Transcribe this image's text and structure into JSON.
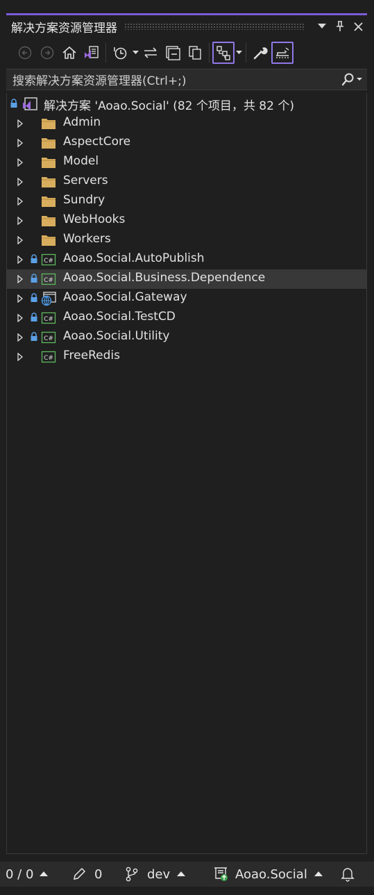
{
  "panel": {
    "title": "解决方案资源管理器",
    "accent_color": "#7c5cd6"
  },
  "search": {
    "placeholder": "搜索解决方案资源管理器(Ctrl+;)"
  },
  "solution": {
    "label": "解决方案 'Aoao.Social' (82 个项目，共 82 个)"
  },
  "tree": {
    "folders": [
      {
        "label": "Admin"
      },
      {
        "label": "AspectCore"
      },
      {
        "label": "Model"
      },
      {
        "label": "Servers"
      },
      {
        "label": "Sundry"
      },
      {
        "label": "WebHooks"
      },
      {
        "label": "Workers"
      }
    ],
    "projects": [
      {
        "label": "Aoao.Social.AutoPublish",
        "icon": "csharp-project-icon",
        "locked": true
      },
      {
        "label": "Aoao.Social.Business.Dependence",
        "icon": "csharp-project-icon",
        "locked": true,
        "selected": true
      },
      {
        "label": "Aoao.Social.Gateway",
        "icon": "web-project-icon",
        "locked": true
      },
      {
        "label": "Aoao.Social.TestCD",
        "icon": "csharp-project-icon",
        "locked": true
      },
      {
        "label": "Aoao.Social.Utility",
        "icon": "csharp-project-icon",
        "locked": true
      },
      {
        "label": "FreeRedis",
        "icon": "csharp-project-icon",
        "locked": false
      }
    ]
  },
  "statusbar": {
    "errors": "0 / 0",
    "edits": "0",
    "branch": "dev",
    "repo": "Aoao.Social"
  }
}
